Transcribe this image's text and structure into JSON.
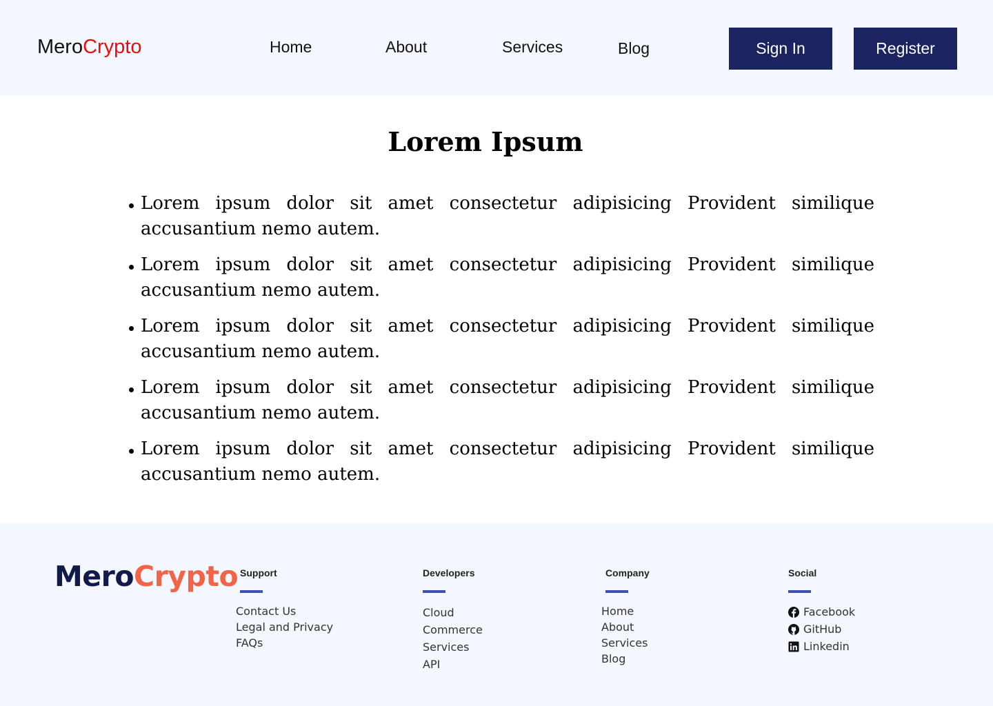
{
  "header": {
    "logo": {
      "part1": "Mero",
      "part2": "Crypto"
    },
    "nav": [
      {
        "label": "Home"
      },
      {
        "label": "About"
      },
      {
        "label": "Services"
      },
      {
        "label": "Blog"
      }
    ],
    "sign_in_label": "Sign In",
    "register_label": "Register"
  },
  "main": {
    "title": "Lorem Ipsum",
    "items": [
      "Lorem ipsum dolor sit amet consectetur adipisicing Provident similique accusantium nemo autem.",
      "Lorem ipsum dolor sit amet consectetur adipisicing Provident similique accusantium nemo autem.",
      "Lorem ipsum dolor sit amet consectetur adipisicing Provident similique accusantium nemo autem.",
      "Lorem ipsum dolor sit amet consectetur adipisicing Provident similique accusantium nemo autem.",
      "Lorem ipsum dolor sit amet consectetur adipisicing Provident similique accusantium nemo autem."
    ]
  },
  "footer": {
    "logo": {
      "part1": "Mero",
      "part2": "Crypto"
    },
    "support": {
      "heading": "Support",
      "links": [
        "Contact Us",
        "Legal and Privacy",
        "FAQs"
      ]
    },
    "developers": {
      "heading": "Developers",
      "links": [
        "Cloud",
        "Commerce",
        "Services",
        "API"
      ]
    },
    "company": {
      "heading": "Company",
      "links": [
        "Home",
        "About",
        "Services",
        "Blog"
      ]
    },
    "social": {
      "heading": "Social",
      "links": [
        {
          "label": "Facebook",
          "icon": "facebook-icon"
        },
        {
          "label": "GitHub",
          "icon": "github-icon"
        },
        {
          "label": "Linkedin",
          "icon": "linkedin-icon"
        }
      ]
    }
  },
  "colors": {
    "header_bg": "#f4f7fe",
    "button_bg": "#1b2460",
    "logo_accent": "#ee0a0a",
    "footer_logo_dark": "#111a48",
    "footer_logo_accent": "#f26447",
    "footer_underline": "#3f51b5"
  }
}
